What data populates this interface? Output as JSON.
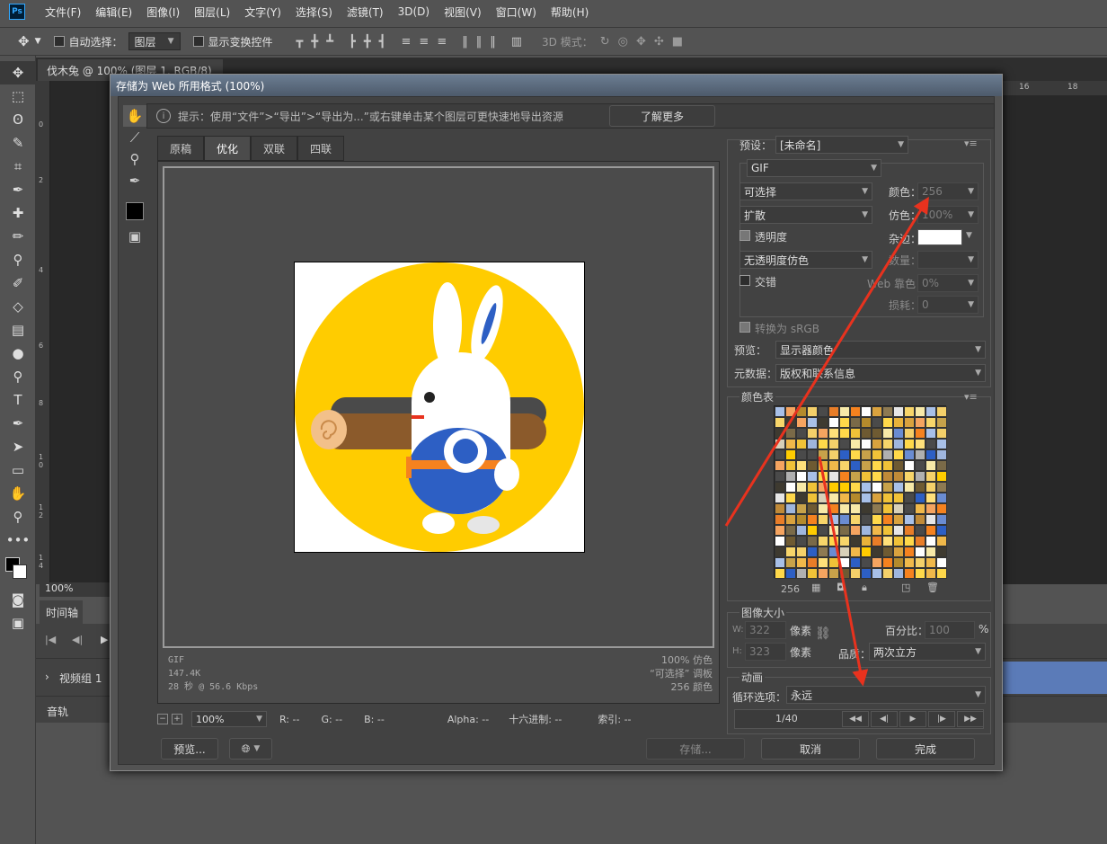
{
  "app": {
    "menus": [
      "文件(F)",
      "编辑(E)",
      "图像(I)",
      "图层(L)",
      "文字(Y)",
      "选择(S)",
      "滤镜(T)",
      "3D(D)",
      "视图(V)",
      "窗口(W)",
      "帮助(H)"
    ],
    "logo": "Ps"
  },
  "options": {
    "auto_select_label": "自动选择：",
    "layer_select": "图层",
    "show_transform_label": "显示变换控件",
    "mode_3d_label": "3D 模式："
  },
  "document": {
    "tab_title": "伐木兔 @ 100% (图层 1, RGB/8)",
    "zoom": "100%",
    "ruler_top": [
      "16",
      "18"
    ],
    "ruler_left": [
      "0",
      "2",
      "4",
      "6",
      "8",
      "1\n0",
      "1\n2",
      "1\n4"
    ]
  },
  "timeline": {
    "tab": "时间轴",
    "video_group": "视频组 1",
    "audio": "音轨"
  },
  "dialog": {
    "title": "存储为 Web 所用格式 (100%)",
    "hint": "提示：使用“文件”>“导出”>“导出为...”或右键单击某个图层可更快速地导出资源",
    "learn_more": "了解更多",
    "view_tabs": [
      "原稿",
      "优化",
      "双联",
      "四联"
    ],
    "info_left": [
      "GIF",
      "147.4K",
      "28 秒 @ 56.6 Kbps"
    ],
    "info_right": [
      "100% 仿色",
      "“可选择” 调板",
      "256 颜色"
    ],
    "status": {
      "zoom": "100%",
      "r": "R: --",
      "g": "G: --",
      "b": "B: --",
      "alpha": "Alpha: --",
      "hex": "十六进制: --",
      "index": "索引: --"
    },
    "buttons": {
      "preview": "预览...",
      "save": "存储...",
      "cancel": "取消",
      "done": "完成"
    },
    "settings": {
      "preset_label": "预设：",
      "preset_value": "[未命名]",
      "format": "GIF",
      "reduction": "可选择",
      "dither_algo": "扩散",
      "transparency": "透明度",
      "matte_dither": "无透明度仿色",
      "interlaced": "交错",
      "colors_label": "颜色：",
      "colors_value": "256",
      "dither_label": "仿色：",
      "dither_value": "100%",
      "matte_label": "杂边：",
      "amount_label": "数量：",
      "websnap_label": "Web 靠色：",
      "websnap_value": "0%",
      "lossy_label": "损耗：",
      "lossy_value": "0",
      "convert_srgb": "转换为 sRGB",
      "preview_label": "预览：",
      "preview_value": "显示器颜色",
      "metadata_label": "元数据：",
      "metadata_value": "版权和联系信息"
    },
    "color_table": {
      "title": "颜色表",
      "count": "256"
    },
    "image_size": {
      "title": "图像大小",
      "w_label": "W:",
      "w_value": "322",
      "h_label": "H:",
      "h_value": "323",
      "unit": "像素",
      "percent_label": "百分比：",
      "percent_value": "100",
      "percent_unit": "%",
      "quality_label": "品质：",
      "quality_value": "两次立方"
    },
    "animation": {
      "title": "动画",
      "loop_label": "循环选项：",
      "loop_value": "永远",
      "frame": "1/40"
    }
  },
  "colors": {
    "accent_annotation": "#e8321e",
    "timeline_bar": "#5b7bb8",
    "rabbit_circle": "#ffcc00",
    "rabbit_blue": "#2d5fc4",
    "rabbit_orange": "#f5821f",
    "log_brown": "#8b5a2b"
  },
  "palette_colors": [
    "#f0c238",
    "#ffffff",
    "#f7e9a8",
    "#b48a2c",
    "#ffd84a",
    "#3e3a30",
    "#e8b23a",
    "#f4d06a",
    "#c7a24a",
    "#8e7a52",
    "#ffe07a",
    "#6e5a32",
    "#f0b84a",
    "#d9a23e",
    "#4a4a4a",
    "#a8c0e8",
    "#e87d28",
    "#f5a460",
    "#ffffff",
    "#d8d0b8",
    "#9fb6de",
    "#f7d56a",
    "#c08a38",
    "#2d5fc4",
    "#f0c238",
    "#e6e6e6",
    "#ffcc00",
    "#b0b0b0",
    "#f5821f",
    "#6a8cd2",
    "#ffd84a",
    "#7a6a48"
  ]
}
